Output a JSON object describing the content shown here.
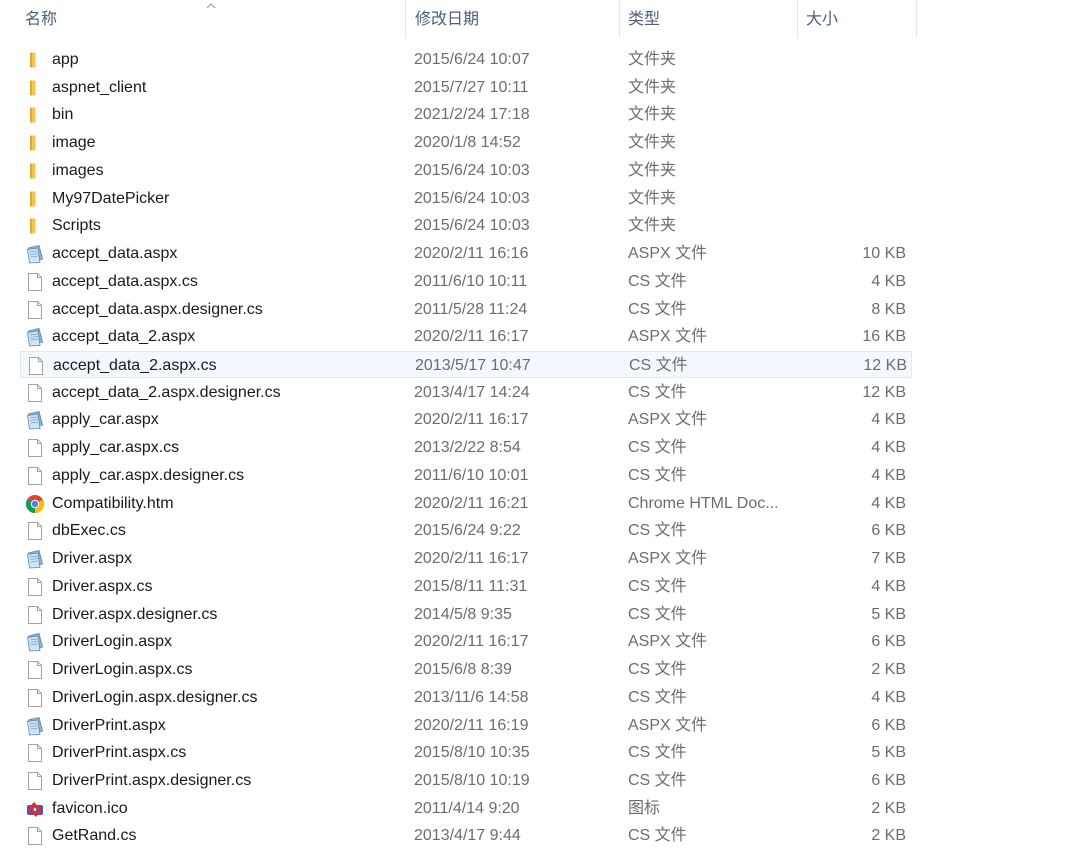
{
  "columns": {
    "name": "名称",
    "date": "修改日期",
    "type": "类型",
    "size": "大小"
  },
  "files": [
    {
      "name": "app",
      "date": "2015/6/24 10:07",
      "type": "文件夹",
      "size": "",
      "icon": "folder-icon"
    },
    {
      "name": "aspnet_client",
      "date": "2015/7/27 10:11",
      "type": "文件夹",
      "size": "",
      "icon": "folder-icon"
    },
    {
      "name": "bin",
      "date": "2021/2/24 17:18",
      "type": "文件夹",
      "size": "",
      "icon": "folder-icon"
    },
    {
      "name": "image",
      "date": "2020/1/8 14:52",
      "type": "文件夹",
      "size": "",
      "icon": "folder-icon"
    },
    {
      "name": "images",
      "date": "2015/6/24 10:03",
      "type": "文件夹",
      "size": "",
      "icon": "folder-icon"
    },
    {
      "name": "My97DatePicker",
      "date": "2015/6/24 10:03",
      "type": "文件夹",
      "size": "",
      "icon": "folder-icon"
    },
    {
      "name": "Scripts",
      "date": "2015/6/24 10:03",
      "type": "文件夹",
      "size": "",
      "icon": "folder-icon"
    },
    {
      "name": "accept_data.aspx",
      "date": "2020/2/11 16:16",
      "type": "ASPX 文件",
      "size": "10 KB",
      "icon": "aspx-file-icon"
    },
    {
      "name": "accept_data.aspx.cs",
      "date": "2011/6/10 10:11",
      "type": "CS 文件",
      "size": "4 KB",
      "icon": "blank-file-icon"
    },
    {
      "name": "accept_data.aspx.designer.cs",
      "date": "2011/5/28 11:24",
      "type": "CS 文件",
      "size": "8 KB",
      "icon": "blank-file-icon"
    },
    {
      "name": "accept_data_2.aspx",
      "date": "2020/2/11 16:17",
      "type": "ASPX 文件",
      "size": "16 KB",
      "icon": "aspx-file-icon"
    },
    {
      "name": "accept_data_2.aspx.cs",
      "date": "2013/5/17 10:47",
      "type": "CS 文件",
      "size": "12 KB",
      "icon": "blank-file-icon",
      "selected": true
    },
    {
      "name": "accept_data_2.aspx.designer.cs",
      "date": "2013/4/17 14:24",
      "type": "CS 文件",
      "size": "12 KB",
      "icon": "blank-file-icon"
    },
    {
      "name": "apply_car.aspx",
      "date": "2020/2/11 16:17",
      "type": "ASPX 文件",
      "size": "4 KB",
      "icon": "aspx-file-icon"
    },
    {
      "name": "apply_car.aspx.cs",
      "date": "2013/2/22 8:54",
      "type": "CS 文件",
      "size": "4 KB",
      "icon": "blank-file-icon"
    },
    {
      "name": "apply_car.aspx.designer.cs",
      "date": "2011/6/10 10:01",
      "type": "CS 文件",
      "size": "4 KB",
      "icon": "blank-file-icon"
    },
    {
      "name": "Compatibility.htm",
      "date": "2020/2/11 16:21",
      "type": "Chrome HTML Doc...",
      "size": "4 KB",
      "icon": "chrome-icon"
    },
    {
      "name": "dbExec.cs",
      "date": "2015/6/24 9:22",
      "type": "CS 文件",
      "size": "6 KB",
      "icon": "blank-file-icon"
    },
    {
      "name": "Driver.aspx",
      "date": "2020/2/11 16:17",
      "type": "ASPX 文件",
      "size": "7 KB",
      "icon": "aspx-file-icon"
    },
    {
      "name": "Driver.aspx.cs",
      "date": "2015/8/11 11:31",
      "type": "CS 文件",
      "size": "4 KB",
      "icon": "blank-file-icon"
    },
    {
      "name": "Driver.aspx.designer.cs",
      "date": "2014/5/8 9:35",
      "type": "CS 文件",
      "size": "5 KB",
      "icon": "blank-file-icon"
    },
    {
      "name": "DriverLogin.aspx",
      "date": "2020/2/11 16:17",
      "type": "ASPX 文件",
      "size": "6 KB",
      "icon": "aspx-file-icon"
    },
    {
      "name": "DriverLogin.aspx.cs",
      "date": "2015/6/8 8:39",
      "type": "CS 文件",
      "size": "2 KB",
      "icon": "blank-file-icon"
    },
    {
      "name": "DriverLogin.aspx.designer.cs",
      "date": "2013/11/6 14:58",
      "type": "CS 文件",
      "size": "4 KB",
      "icon": "blank-file-icon"
    },
    {
      "name": "DriverPrint.aspx",
      "date": "2020/2/11 16:19",
      "type": "ASPX 文件",
      "size": "6 KB",
      "icon": "aspx-file-icon"
    },
    {
      "name": "DriverPrint.aspx.cs",
      "date": "2015/8/10 10:35",
      "type": "CS 文件",
      "size": "5 KB",
      "icon": "blank-file-icon"
    },
    {
      "name": "DriverPrint.aspx.designer.cs",
      "date": "2015/8/10 10:19",
      "type": "CS 文件",
      "size": "6 KB",
      "icon": "blank-file-icon"
    },
    {
      "name": "favicon.ico",
      "date": "2011/4/14 9:20",
      "type": "图标",
      "size": "2 KB",
      "icon": "ico-file-icon"
    },
    {
      "name": "GetRand.cs",
      "date": "2013/4/17 9:44",
      "type": "CS 文件",
      "size": "2 KB",
      "icon": "blank-file-icon"
    }
  ],
  "colors": {
    "header_text": "#4c607a",
    "selected_bg": "#f2f8fe",
    "selected_border": "#d9ebfb",
    "folder": "#f3c64f"
  }
}
